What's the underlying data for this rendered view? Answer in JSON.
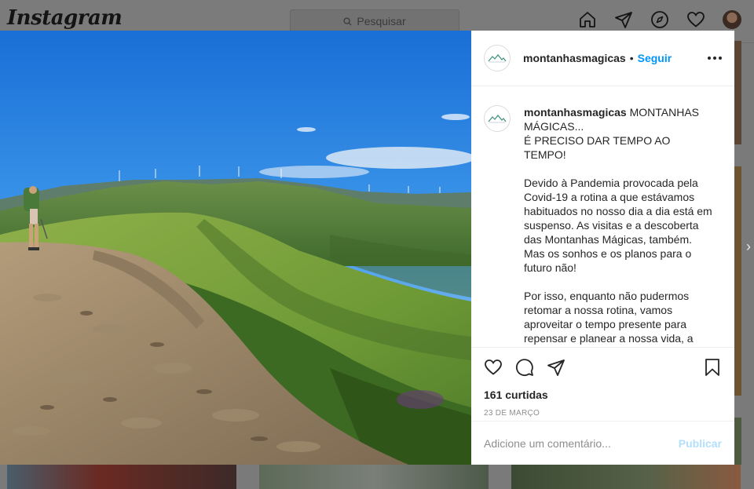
{
  "topbar": {
    "logo_text": "Instagram",
    "search_placeholder": "Pesquisar",
    "icons": [
      "home-icon",
      "direct-icon",
      "explore-icon",
      "activity-heart-icon",
      "profile-avatar"
    ]
  },
  "post": {
    "username": "montanhasmagicas",
    "separator": "•",
    "follow_label": "Seguir",
    "caption": {
      "username": "montanhasmagicas",
      "lines": [
        "MONTANHAS MÁGICAS...",
        "É PRECISO DAR TEMPO AO TEMPO!",
        "",
        "Devido à Pandemia provocada pela Covid-19 a rotina a que estávamos habituados no nosso dia a dia está em suspenso. As visitas e a descoberta das Montanhas Mágicas, também. Mas os sonhos e os planos para o futuro não!",
        "",
        "Por isso, enquanto não pudermos retomar a nossa rotina, vamos aproveitar o tempo presente para repensar e planear a nossa vida, a todos os níveis – saúde, família,"
      ]
    },
    "likes": "161 curtidas",
    "date": "23 DE MARÇO",
    "comment_placeholder": "Adicione um comentário...",
    "publish_label": "Publicar",
    "photo": "mountain trail hiker landscape"
  },
  "colors": {
    "accent": "#0095f6",
    "publish_disabled": "#b2dffc",
    "muted": "#8e8e8e",
    "overlay": "#7a7a7a"
  }
}
